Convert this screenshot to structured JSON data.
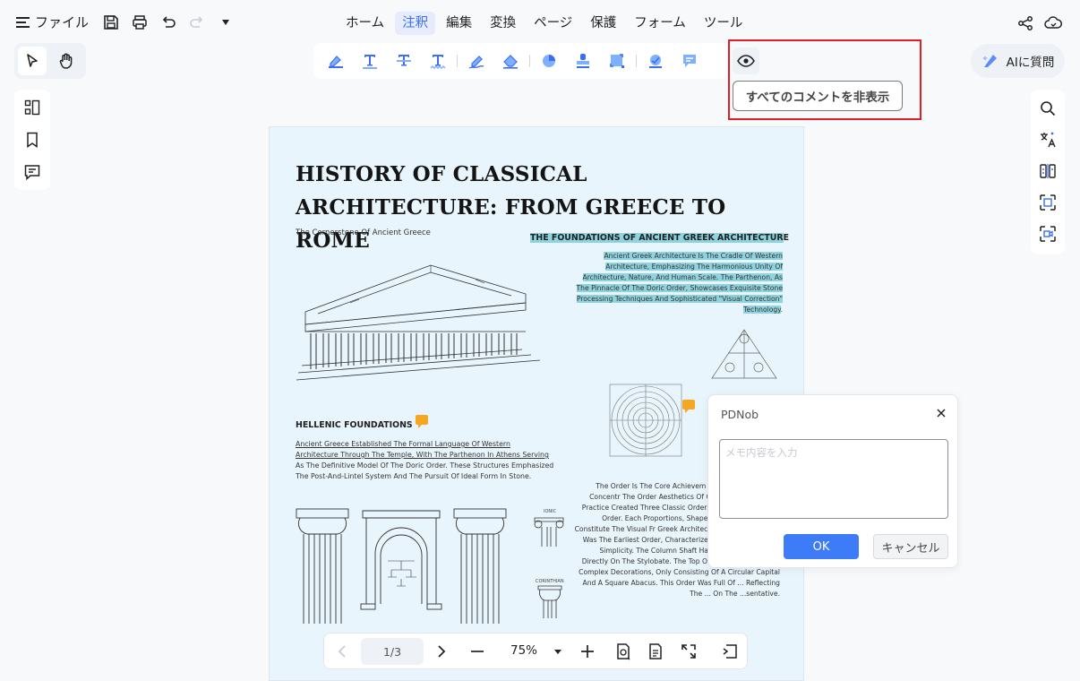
{
  "topbar": {
    "file_label": "ファイル",
    "menu": [
      "ホーム",
      "注釈",
      "編集",
      "変換",
      "ページ",
      "保護",
      "フォーム",
      "ツール"
    ],
    "active_menu": "注釈"
  },
  "tooltip": {
    "hide_comments": "すべてのコメントを非表示"
  },
  "ai_button": {
    "label": "AIに質問"
  },
  "document": {
    "title": "HISTORY OF CLASSICAL  ARCHITECTURE: FROM GREECE TO ROME",
    "subtitle": "The Cornerstone Of Ancient Greece",
    "foundations_title_hl": "THE FOUNDATIONS OF ANCIENT GREEK ARCHITECTUR",
    "foundations_title_tail": "E",
    "foundations_body_hl": "Ancient Greek Architecture Is The Cradle Of Western Architecture, Emphasizing The Harmonious Unity Of Architecture, Nature, And Human Scale. The Parthenon, As The Pinnacle Of The Doric Order, Showcases Exquisite Stone Processing Techniques And Sophisticated \"Visual Correction\" Technology",
    "foundations_body_tail": ".",
    "hellenic_title": "HELLENIC FOUNDATIONS",
    "hellenic_body_ul": "Ancient Greece Established The Formal Language Of Western Architecture Through The Temple, With The Parthenon In Athens Serving",
    "hellenic_body_rest": " As The Definitive Model Of The Doric Order. These Structures Emphasized The Post-And-Lintel System And The Pursuit Of Ideal Form In Stone.",
    "orders_body": "The Order Is The Core Achievem Architecture And The Concentr The Order Aesthetics Of Cl Through Long-Term Practice Created Three Classic Orders: Dor And Corinthian Order. Each Proportions, Shapes And Symb Together Constitute The Visual Fr Greek Architecture. The Doric Order Was The Earliest Order, Characterized By Robustness And Simplicity. The Column Shaft Had No Base And Stood Directly On The Stylobate. The Top Of The Column Had No Complex Decorations, Only Consisting Of A Circular Capital And A Square Abacus. This Order Was Full Of ... Reflecting The ... On The ...sentative.",
    "ionic_label": "IONIC",
    "corinthian_label": "CORINTHIAN"
  },
  "popup": {
    "title": "PDNob",
    "placeholder": "メモ内容を入力",
    "ok_label": "OK",
    "cancel_label": "キャンセル"
  },
  "bottom": {
    "page_indicator": "1/3",
    "zoom": "75%"
  },
  "colors": {
    "accent": "#3b6ef5",
    "highlight": "#8fd3df",
    "note": "#f5a623",
    "callout": "#e11d2a"
  }
}
